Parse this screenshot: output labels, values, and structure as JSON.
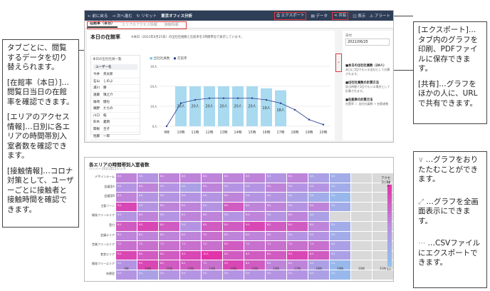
{
  "toolbar": {
    "back": "← 前に戻る",
    "forward": "→ 次へ進む",
    "reset": "リセット",
    "report_name": "東京オフィス分析",
    "export": "エクスポート",
    "data": "データ",
    "share": "共有",
    "view": "表示",
    "alert": "アラート"
  },
  "tabs": [
    {
      "label": "在館率（本日）"
    },
    {
      "label": "エリアのアクセス情報"
    },
    {
      "label": "接触情報"
    }
  ],
  "today": {
    "title": "本日の在館率",
    "note": "※本日（2021年6月25日）の出社社員数と在館率を1時間単位で表示しています。",
    "list_title": "本日の出社社員一覧",
    "list_header": "ユーザー名",
    "users": [
      {
        "last": "今井",
        "first": "英太郎"
      },
      {
        "last": "石山",
        "first": "しのぶ"
      },
      {
        "last": "浦川",
        "first": "勝"
      },
      {
        "last": "遠藤",
        "first": "慎之介"
      },
      {
        "last": "尾崎",
        "first": "健也"
      },
      {
        "last": "梶野",
        "first": "たちの"
      },
      {
        "last": "川口",
        "first": "拓"
      },
      {
        "last": "鈴木",
        "first": "義明"
      },
      {
        "last": "関根",
        "first": "圭子"
      },
      {
        "last": "佐藤",
        "first": "一郎"
      }
    ],
    "legend_count": "出社社員数",
    "legend_rate": "在館率",
    "y_labels": [
      "30人",
      "20人",
      "10人",
      "0人"
    ],
    "filter_title": "日付",
    "filter_date": "2021/06/25",
    "info": [
      {
        "title": "■本日の出社社員数（20人）",
        "body": "本日に1回でもいる出社として計算されます。"
      },
      {
        "title": "■出社社員数の計算方法",
        "body": "該当時間で1回でもいる場合として計算されます。"
      },
      {
        "title": "■在館率の計算方法",
        "body": "在館率 ＝ 出社社員数 ÷ 在館者数"
      }
    ]
  },
  "chart_data": [
    {
      "type": "bar",
      "categories": [
        "9時",
        "10時",
        "11時",
        "12時",
        "13時",
        "14時",
        "15時",
        "16時",
        "17時",
        "18時",
        "19時",
        "20時"
      ],
      "series": [
        {
          "name": "出社社員数",
          "values": [
            0,
            20,
            20,
            20,
            20,
            20,
            20,
            19,
            18,
            0,
            0,
            0
          ]
        },
        {
          "name": "在館率",
          "values": [
            0,
            70,
            80,
            85,
            85,
            85,
            85,
            80,
            70,
            50,
            20,
            5
          ]
        }
      ],
      "data_labels": [
        "",
        "20人",
        "20人",
        "20人",
        "20人",
        "20人",
        "20人",
        "19人",
        "18人",
        "",
        "",
        ""
      ],
      "ylim": [
        0,
        30
      ]
    },
    {
      "type": "heatmap",
      "title": "各エリアの時間帯別入室者数",
      "subtitle": "ハンハー2021年ロジック",
      "rows": [
        "デザインルーム",
        "会議室A",
        "会議室B",
        "主要ゾーン",
        "開発フリーエリア",
        "受付",
        "会議エリア",
        "営業フリーエリア",
        "食堂エリア",
        "開発フリーエリア",
        "休憩室"
      ],
      "columns": [
        "9時",
        "10時",
        "11時",
        "12時",
        "13時",
        "14時",
        "15時",
        "16時",
        "17時",
        "18時",
        "19時",
        "20時",
        "21時"
      ],
      "legend_title": "アクセス(人)",
      "legend_max": "10人",
      "legend_min": "1人",
      "values": [
        [
          6,
          5,
          6,
          6,
          6,
          6,
          6,
          5,
          6,
          4,
          3,
          0,
          0
        ],
        [
          5,
          6,
          5,
          4,
          6,
          5,
          5,
          6,
          5,
          5,
          3,
          0,
          0
        ],
        [
          6,
          5,
          5,
          5,
          5,
          6,
          5,
          5,
          4,
          3,
          2,
          0,
          0
        ],
        [
          9,
          5,
          6,
          6,
          5,
          8,
          6,
          6,
          5,
          6,
          3,
          0,
          0
        ],
        [
          5,
          6,
          5,
          6,
          6,
          5,
          6,
          5,
          6,
          4,
          0,
          0,
          0
        ],
        [
          8,
          9,
          8,
          5,
          8,
          8,
          9,
          8,
          8,
          6,
          3,
          0,
          0
        ],
        [
          6,
          6,
          6,
          6,
          7,
          6,
          6,
          6,
          5,
          5,
          3,
          0,
          0
        ],
        [
          7,
          7,
          7,
          7,
          7,
          8,
          7,
          7,
          7,
          7,
          4,
          0,
          0
        ],
        [
          9,
          8,
          8,
          9,
          10,
          8,
          8,
          8,
          9,
          8,
          4,
          0,
          0
        ],
        [
          5,
          9,
          8,
          8,
          7,
          9,
          8,
          6,
          6,
          4,
          2,
          0,
          0
        ],
        [
          5,
          4,
          5,
          5,
          5,
          5,
          5,
          5,
          5,
          4,
          2,
          0,
          0
        ]
      ]
    }
  ],
  "callouts": {
    "left": [
      "タブごとに、閲覧するデータを切り替えられます。",
      "[在館率（本日）]…閲覧日当日の在館率を確認できます。",
      "[エリアのアクセス情報]…日別に各エリアの時間帯別入室者数を確認できます。",
      "[接触情報]…コロナ対策として、ユーザーごとに接触者と接触時間を確認できます。"
    ],
    "right_top": [
      "[エクスポート]…タブ内のグラフを印刷、PDFファイルに保存できます。",
      "[共有]…グラフをほかの人に、URLで共有できます。"
    ],
    "right_bottom": [
      {
        "icon": "∨",
        "text": "…グラフをおりたたむことができます。"
      },
      {
        "icon": "⤢",
        "text": "…グラフを全画面表示にできます。"
      },
      {
        "icon": "⋯",
        "text": "…CSVファイルにエクスポートできます。"
      }
    ]
  }
}
